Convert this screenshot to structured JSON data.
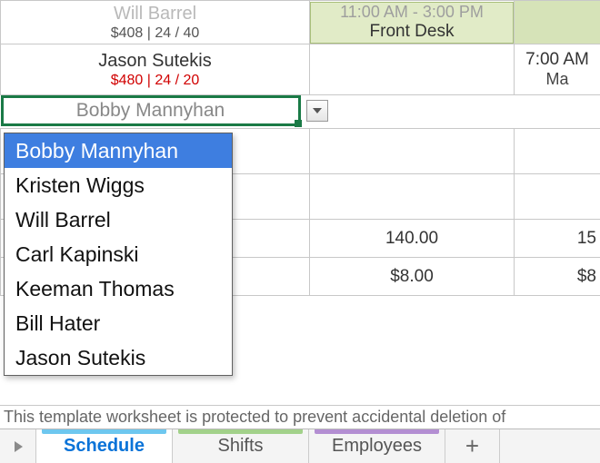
{
  "rows": {
    "r0": {
      "name": "Will Barrel",
      "sub_cost": "$408",
      "sub_sep": " | ",
      "sub_hours": "24 / 40",
      "shift_time": "11:00 AM - 3:00 PM",
      "shift_role": "Front Desk"
    },
    "r1": {
      "name": "Jason Sutekis",
      "sub_cost": "$480",
      "sub_sep": " | ",
      "sub_hours": "24 / 20",
      "right_time": "7:00 AM",
      "right_role": "Ma"
    }
  },
  "active_cell": {
    "value": "Bobby Mannyhan"
  },
  "dropdown": {
    "items": [
      "Bobby Mannyhan",
      "Kristen Wiggs",
      "Will Barrel",
      "Carl Kapinski",
      "Keeman Thomas",
      "Bill Hater",
      "Jason Sutekis"
    ]
  },
  "totals": {
    "row1_b": "140.00",
    "row1_c": "15",
    "row2_b": "$8.00",
    "row2_c": "$8"
  },
  "protect_msg": "This template worksheet is protected to prevent accidental deletion of",
  "tabs": {
    "schedule": "Schedule",
    "shifts": "Shifts",
    "employees": "Employees",
    "add": "+"
  },
  "accents": {
    "schedule": "#6ec7ef",
    "shifts": "#a2d18a",
    "employees": "#b38ed2"
  }
}
